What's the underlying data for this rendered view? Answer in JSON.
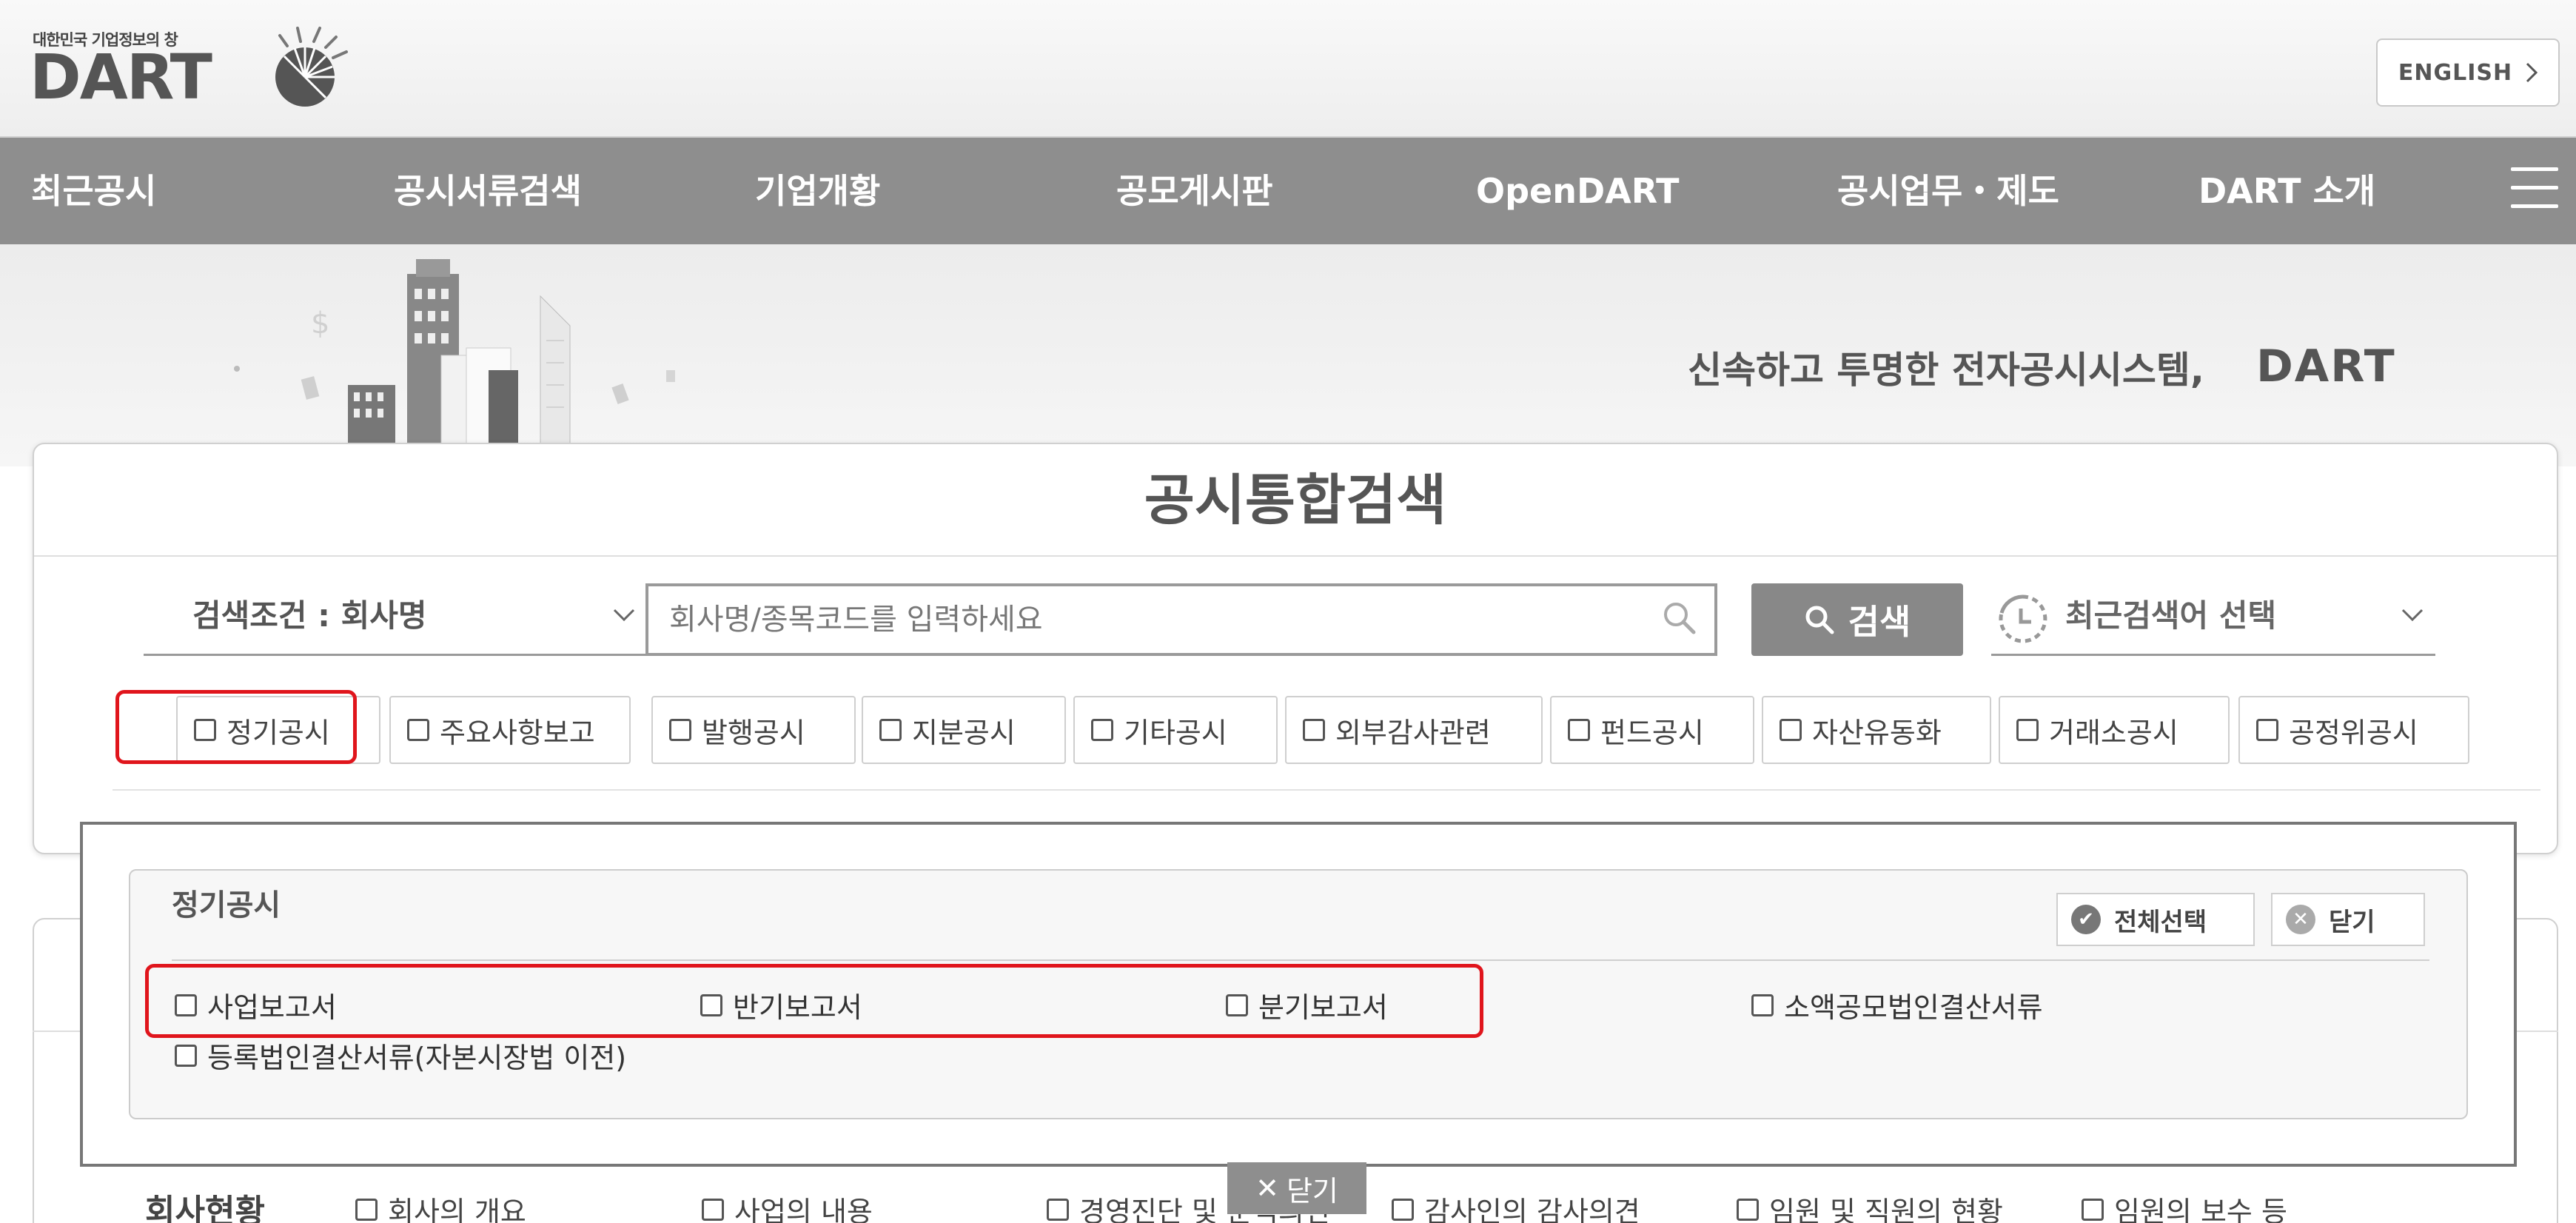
{
  "header": {
    "logo_tagline": "대한민국 기업정보의 창",
    "logo_text": "DART",
    "lang_button": "ENGLISH"
  },
  "nav": {
    "items": [
      "최근공시",
      "공시서류검색",
      "기업개황",
      "공모게시판",
      "OpenDART",
      "공시업무・제도",
      "DART 소개"
    ]
  },
  "hero": {
    "slogan": "신속하고 투명한 전자공시시스템,",
    "slogan_brand": "DART"
  },
  "search": {
    "title": "공시통합검색",
    "condition_label": "검색조건 : 회사명",
    "input_placeholder": "회사명/종목코드를 입력하세요",
    "search_button": "검색",
    "recent_label": "최근검색어 선택",
    "categories": [
      "정기공시",
      "주요사항보고",
      "발행공시",
      "지분공시",
      "기타공시",
      "외부감사관련",
      "펀드공시",
      "자산유동화",
      "거래소공시",
      "공정위공시"
    ]
  },
  "popup": {
    "title": "정기공시",
    "select_all": "전체선택",
    "close": "닫기",
    "items": [
      "사업보고서",
      "반기보고서",
      "분기보고서",
      "소액공모법인결산서류",
      "등록법인결산서류(자본시장법 이전)"
    ],
    "close_tab": "닫기"
  },
  "lower": {
    "section_label": "회사현황",
    "items": [
      "회사의 개요",
      "사업의 내용",
      "경영진단 및 분석의견",
      "감사인의 감사의견",
      "임원 및 직원의 현황",
      "임원의 보수 등"
    ]
  },
  "colors": {
    "nav_bg": "#8e8e8e",
    "highlight": "#e0151c",
    "search_btn": "#888888"
  }
}
